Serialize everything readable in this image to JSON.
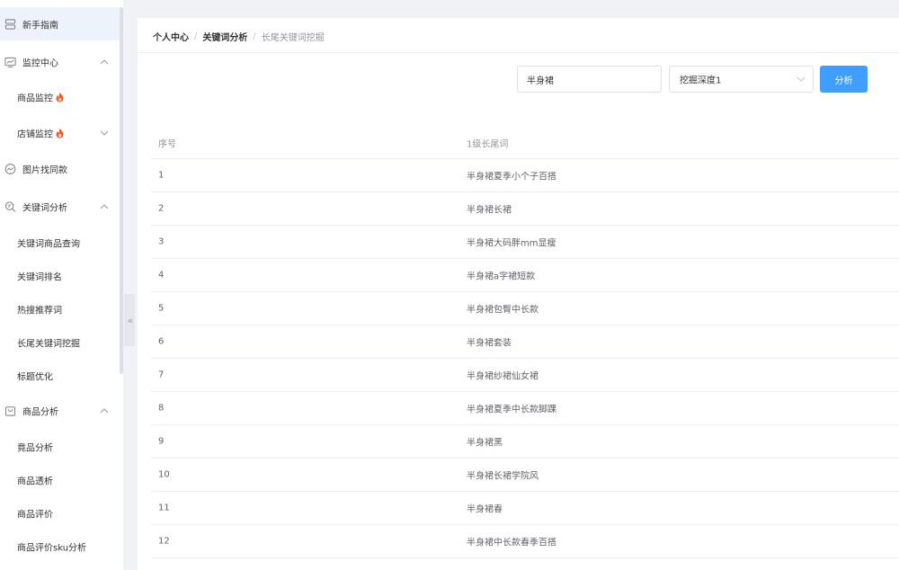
{
  "sidebar": {
    "items": [
      {
        "label": "新手指南",
        "icon": "server-icon",
        "kind": "group",
        "active": true
      },
      {
        "label": "监控中心",
        "icon": "monitor-chart-icon",
        "kind": "group",
        "expanded": true
      },
      {
        "label": "商品监控",
        "kind": "sub",
        "hot": true
      },
      {
        "label": "店铺监控",
        "kind": "sub",
        "hot": true,
        "has_chevron": true
      },
      {
        "label": "图片找同款",
        "icon": "image-search-icon",
        "kind": "group"
      },
      {
        "label": "关键词分析",
        "icon": "keyword-search-icon",
        "kind": "group",
        "expanded": true
      },
      {
        "label": "关键词商品查询",
        "kind": "sub"
      },
      {
        "label": "关键词排名",
        "kind": "sub"
      },
      {
        "label": "热搜推荐词",
        "kind": "sub"
      },
      {
        "label": "长尾关键词挖掘",
        "kind": "sub"
      },
      {
        "label": "标题优化",
        "kind": "sub"
      },
      {
        "label": "商品分析",
        "icon": "shopping-bag-icon",
        "kind": "group",
        "expanded": true
      },
      {
        "label": "竟品分析",
        "kind": "sub"
      },
      {
        "label": "商品透析",
        "kind": "sub"
      },
      {
        "label": "商品评价",
        "kind": "sub"
      },
      {
        "label": "商品评价sku分析",
        "kind": "sub"
      }
    ]
  },
  "breadcrumb": {
    "items": [
      "个人中心",
      "关键词分析",
      "长尾关键词挖掘"
    ],
    "separator": "/"
  },
  "search": {
    "keyword_value": "半身裙",
    "depth_value": "挖掘深度1",
    "submit_label": "分析"
  },
  "table": {
    "headers": [
      "序号",
      "1级长尾词"
    ],
    "rows": [
      [
        "1",
        "半身裙夏季小个子百搭"
      ],
      [
        "2",
        "半身裙长裙"
      ],
      [
        "3",
        "半身裙大码胖mm显瘦"
      ],
      [
        "4",
        "半身裙a字裙短款"
      ],
      [
        "5",
        "半身裙包臀中长款"
      ],
      [
        "6",
        "半身裙套装"
      ],
      [
        "7",
        "半身裙纱裙仙女裙"
      ],
      [
        "8",
        "半身裙夏季中长款脚踝"
      ],
      [
        "9",
        "半身裙黑"
      ],
      [
        "10",
        "半身裙长裙学院风"
      ],
      [
        "11",
        "半身裙春"
      ],
      [
        "12",
        "半身裙中长款春季百搭"
      ]
    ]
  },
  "colors": {
    "primary": "#409eff",
    "sidebar_active_bg": "#eef3fb",
    "hot_icon": "#f05a28",
    "page_bg": "#f0f2f5"
  }
}
